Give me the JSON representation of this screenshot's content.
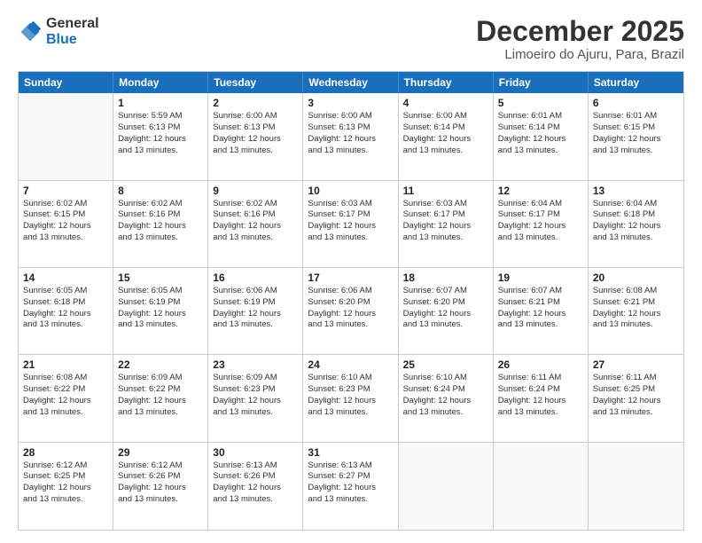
{
  "header": {
    "logo_general": "General",
    "logo_blue": "Blue",
    "month_title": "December 2025",
    "location": "Limoeiro do Ajuru, Para, Brazil"
  },
  "calendar": {
    "days_of_week": [
      "Sunday",
      "Monday",
      "Tuesday",
      "Wednesday",
      "Thursday",
      "Friday",
      "Saturday"
    ],
    "weeks": [
      [
        {
          "day": "",
          "lines": []
        },
        {
          "day": "1",
          "lines": [
            "Sunrise: 5:59 AM",
            "Sunset: 6:13 PM",
            "Daylight: 12 hours",
            "and 13 minutes."
          ]
        },
        {
          "day": "2",
          "lines": [
            "Sunrise: 6:00 AM",
            "Sunset: 6:13 PM",
            "Daylight: 12 hours",
            "and 13 minutes."
          ]
        },
        {
          "day": "3",
          "lines": [
            "Sunrise: 6:00 AM",
            "Sunset: 6:13 PM",
            "Daylight: 12 hours",
            "and 13 minutes."
          ]
        },
        {
          "day": "4",
          "lines": [
            "Sunrise: 6:00 AM",
            "Sunset: 6:14 PM",
            "Daylight: 12 hours",
            "and 13 minutes."
          ]
        },
        {
          "day": "5",
          "lines": [
            "Sunrise: 6:01 AM",
            "Sunset: 6:14 PM",
            "Daylight: 12 hours",
            "and 13 minutes."
          ]
        },
        {
          "day": "6",
          "lines": [
            "Sunrise: 6:01 AM",
            "Sunset: 6:15 PM",
            "Daylight: 12 hours",
            "and 13 minutes."
          ]
        }
      ],
      [
        {
          "day": "7",
          "lines": [
            "Sunrise: 6:02 AM",
            "Sunset: 6:15 PM",
            "Daylight: 12 hours",
            "and 13 minutes."
          ]
        },
        {
          "day": "8",
          "lines": [
            "Sunrise: 6:02 AM",
            "Sunset: 6:16 PM",
            "Daylight: 12 hours",
            "and 13 minutes."
          ]
        },
        {
          "day": "9",
          "lines": [
            "Sunrise: 6:02 AM",
            "Sunset: 6:16 PM",
            "Daylight: 12 hours",
            "and 13 minutes."
          ]
        },
        {
          "day": "10",
          "lines": [
            "Sunrise: 6:03 AM",
            "Sunset: 6:17 PM",
            "Daylight: 12 hours",
            "and 13 minutes."
          ]
        },
        {
          "day": "11",
          "lines": [
            "Sunrise: 6:03 AM",
            "Sunset: 6:17 PM",
            "Daylight: 12 hours",
            "and 13 minutes."
          ]
        },
        {
          "day": "12",
          "lines": [
            "Sunrise: 6:04 AM",
            "Sunset: 6:17 PM",
            "Daylight: 12 hours",
            "and 13 minutes."
          ]
        },
        {
          "day": "13",
          "lines": [
            "Sunrise: 6:04 AM",
            "Sunset: 6:18 PM",
            "Daylight: 12 hours",
            "and 13 minutes."
          ]
        }
      ],
      [
        {
          "day": "14",
          "lines": [
            "Sunrise: 6:05 AM",
            "Sunset: 6:18 PM",
            "Daylight: 12 hours",
            "and 13 minutes."
          ]
        },
        {
          "day": "15",
          "lines": [
            "Sunrise: 6:05 AM",
            "Sunset: 6:19 PM",
            "Daylight: 12 hours",
            "and 13 minutes."
          ]
        },
        {
          "day": "16",
          "lines": [
            "Sunrise: 6:06 AM",
            "Sunset: 6:19 PM",
            "Daylight: 12 hours",
            "and 13 minutes."
          ]
        },
        {
          "day": "17",
          "lines": [
            "Sunrise: 6:06 AM",
            "Sunset: 6:20 PM",
            "Daylight: 12 hours",
            "and 13 minutes."
          ]
        },
        {
          "day": "18",
          "lines": [
            "Sunrise: 6:07 AM",
            "Sunset: 6:20 PM",
            "Daylight: 12 hours",
            "and 13 minutes."
          ]
        },
        {
          "day": "19",
          "lines": [
            "Sunrise: 6:07 AM",
            "Sunset: 6:21 PM",
            "Daylight: 12 hours",
            "and 13 minutes."
          ]
        },
        {
          "day": "20",
          "lines": [
            "Sunrise: 6:08 AM",
            "Sunset: 6:21 PM",
            "Daylight: 12 hours",
            "and 13 minutes."
          ]
        }
      ],
      [
        {
          "day": "21",
          "lines": [
            "Sunrise: 6:08 AM",
            "Sunset: 6:22 PM",
            "Daylight: 12 hours",
            "and 13 minutes."
          ]
        },
        {
          "day": "22",
          "lines": [
            "Sunrise: 6:09 AM",
            "Sunset: 6:22 PM",
            "Daylight: 12 hours",
            "and 13 minutes."
          ]
        },
        {
          "day": "23",
          "lines": [
            "Sunrise: 6:09 AM",
            "Sunset: 6:23 PM",
            "Daylight: 12 hours",
            "and 13 minutes."
          ]
        },
        {
          "day": "24",
          "lines": [
            "Sunrise: 6:10 AM",
            "Sunset: 6:23 PM",
            "Daylight: 12 hours",
            "and 13 minutes."
          ]
        },
        {
          "day": "25",
          "lines": [
            "Sunrise: 6:10 AM",
            "Sunset: 6:24 PM",
            "Daylight: 12 hours",
            "and 13 minutes."
          ]
        },
        {
          "day": "26",
          "lines": [
            "Sunrise: 6:11 AM",
            "Sunset: 6:24 PM",
            "Daylight: 12 hours",
            "and 13 minutes."
          ]
        },
        {
          "day": "27",
          "lines": [
            "Sunrise: 6:11 AM",
            "Sunset: 6:25 PM",
            "Daylight: 12 hours",
            "and 13 minutes."
          ]
        }
      ],
      [
        {
          "day": "28",
          "lines": [
            "Sunrise: 6:12 AM",
            "Sunset: 6:25 PM",
            "Daylight: 12 hours",
            "and 13 minutes."
          ]
        },
        {
          "day": "29",
          "lines": [
            "Sunrise: 6:12 AM",
            "Sunset: 6:26 PM",
            "Daylight: 12 hours",
            "and 13 minutes."
          ]
        },
        {
          "day": "30",
          "lines": [
            "Sunrise: 6:13 AM",
            "Sunset: 6:26 PM",
            "Daylight: 12 hours",
            "and 13 minutes."
          ]
        },
        {
          "day": "31",
          "lines": [
            "Sunrise: 6:13 AM",
            "Sunset: 6:27 PM",
            "Daylight: 12 hours",
            "and 13 minutes."
          ]
        },
        {
          "day": "",
          "lines": []
        },
        {
          "day": "",
          "lines": []
        },
        {
          "day": "",
          "lines": []
        }
      ]
    ]
  }
}
